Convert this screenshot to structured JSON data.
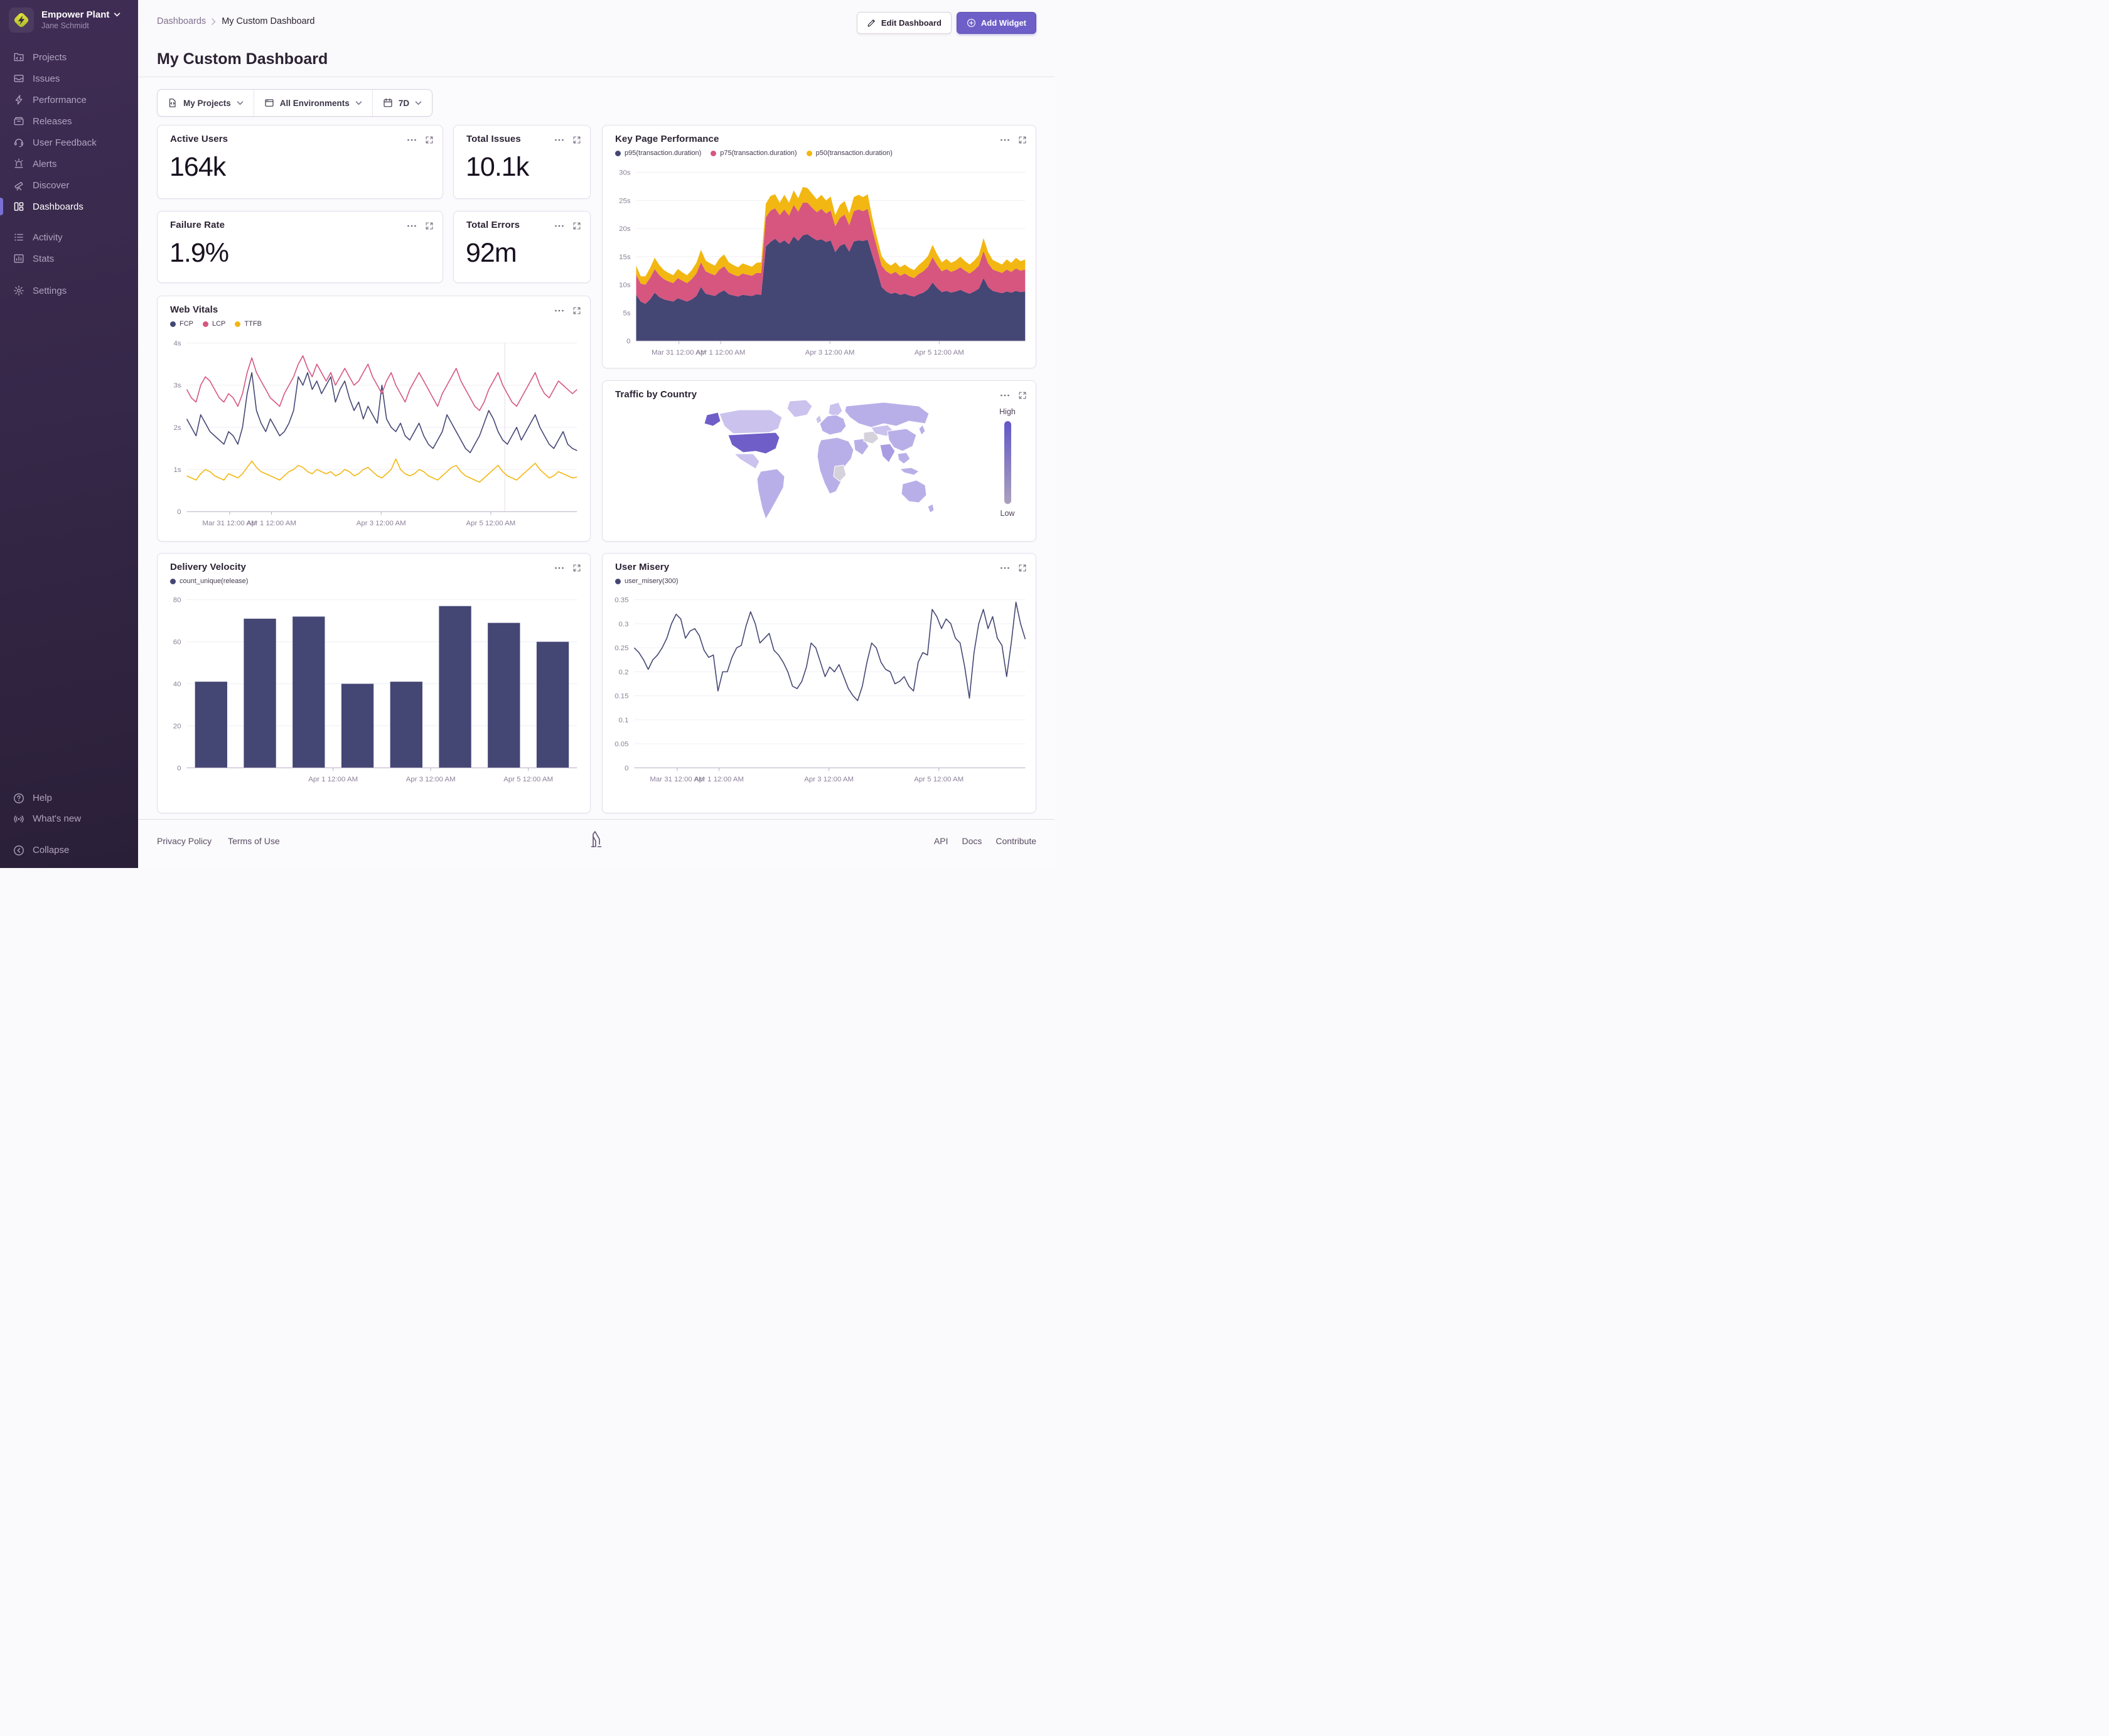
{
  "sidebar": {
    "org": "Empower Plant",
    "user": "Jane Schmidt",
    "items": [
      {
        "label": "Projects"
      },
      {
        "label": "Issues"
      },
      {
        "label": "Performance"
      },
      {
        "label": "Releases"
      },
      {
        "label": "User Feedback"
      },
      {
        "label": "Alerts"
      },
      {
        "label": "Discover"
      },
      {
        "label": "Dashboards",
        "active": true
      },
      {
        "label": "Activity"
      },
      {
        "label": "Stats"
      },
      {
        "label": "Settings"
      }
    ],
    "footer": [
      {
        "label": "Help"
      },
      {
        "label": "What's new"
      },
      {
        "label": "Collapse"
      }
    ]
  },
  "header": {
    "breadcrumb_parent": "Dashboards",
    "breadcrumb_current": "My Custom Dashboard",
    "title": "My Custom Dashboard",
    "edit_label": "Edit Dashboard",
    "add_label": "Add Widget"
  },
  "filters": {
    "projects": "My Projects",
    "environments": "All Environments",
    "period": "7D"
  },
  "cards": {
    "active_users": {
      "title": "Active Users",
      "value": "164k"
    },
    "total_issues": {
      "title": "Total Issues",
      "value": "10.1k"
    },
    "failure_rate": {
      "title": "Failure Rate",
      "value": "1.9%"
    },
    "total_errors": {
      "title": "Total Errors",
      "value": "92m"
    }
  },
  "footer": {
    "links_left": [
      "Privacy Policy",
      "Terms of Use"
    ],
    "links_right": [
      "API",
      "Docs",
      "Contribute"
    ]
  },
  "colors": {
    "accent": "#6d5fc7",
    "navy": "#444674",
    "pink": "#d6567f",
    "yellow": "#f2b712"
  },
  "chart_data": [
    {
      "id": "key-page-performance",
      "type": "area",
      "stacked": true,
      "title": "Key Page Performance",
      "ylim": [
        0,
        30
      ],
      "yticks": [
        "0",
        "5s",
        "10s",
        "15s",
        "20s",
        "25s",
        "30s"
      ],
      "xticks": [
        {
          "f": 0.11,
          "label": "Mar 31 12:00 AM"
        },
        {
          "f": 0.217,
          "label": "Apr 1 12:00 AM"
        },
        {
          "f": 0.498,
          "label": "Apr 3 12:00 AM"
        },
        {
          "f": 0.779,
          "label": "Apr 5 12:00 AM"
        }
      ],
      "series": [
        {
          "name": "p95(transaction.duration)",
          "color": "#444674",
          "values": [
            8.2,
            7.0,
            6.6,
            7.4,
            8.6,
            7.8,
            7.4,
            7.2,
            7.0,
            7.6,
            7.3,
            7.0,
            7.4,
            8.0,
            9.6,
            8.4,
            8.2,
            8.0,
            8.6,
            9.0,
            8.3,
            8.1,
            7.9,
            8.2,
            8.1,
            8.0,
            8.3,
            8.2,
            16.8,
            17.6,
            18.2,
            17.4,
            17.9,
            17.2,
            18.6,
            17.8,
            18.8,
            19.0,
            18.4,
            17.9,
            18.1,
            17.6,
            17.9,
            15.8,
            16.9,
            17.3,
            15.9,
            17.7,
            17.9,
            17.8,
            18.0,
            15.2,
            12.6,
            9.6,
            8.8,
            8.4,
            8.6,
            8.2,
            8.4,
            8.1,
            7.9,
            8.3,
            8.6,
            9.2,
            10.4,
            9.4,
            8.7,
            8.9,
            8.6,
            8.8,
            9.1,
            8.7,
            8.4,
            8.8,
            9.3,
            11.2,
            9.6,
            8.9,
            8.7,
            8.5,
            8.8,
            8.6,
            8.9,
            8.7,
            8.8
          ]
        },
        {
          "name": "p75(transaction.duration)",
          "color": "#d6567f",
          "values": [
            3.6,
            3.2,
            3.4,
            3.8,
            4.2,
            3.9,
            3.6,
            3.4,
            3.3,
            3.6,
            3.4,
            3.3,
            3.6,
            4.0,
            4.4,
            4.0,
            3.8,
            3.7,
            4.1,
            4.3,
            3.9,
            3.7,
            3.6,
            3.8,
            3.7,
            3.6,
            3.8,
            3.9,
            5.2,
            5.6,
            5.4,
            5.0,
            5.5,
            5.1,
            5.6,
            5.2,
            5.8,
            5.6,
            5.3,
            5.0,
            5.4,
            5.1,
            5.3,
            4.6,
            5.0,
            5.2,
            4.7,
            5.4,
            5.5,
            5.3,
            5.5,
            4.6,
            4.0,
            3.8,
            3.6,
            3.5,
            3.7,
            3.4,
            3.6,
            3.4,
            3.3,
            3.6,
            3.8,
            4.0,
            4.5,
            4.1,
            3.7,
            3.9,
            3.7,
            3.8,
            4.0,
            3.8,
            3.6,
            3.8,
            4.1,
            4.8,
            4.2,
            3.8,
            3.7,
            3.6,
            3.9,
            3.7,
            4.0,
            3.8,
            3.9
          ]
        },
        {
          "name": "p50(transaction.duration)",
          "color": "#f2b712",
          "values": [
            1.6,
            1.3,
            1.5,
            1.8,
            2.0,
            1.8,
            1.6,
            1.5,
            1.4,
            1.6,
            1.5,
            1.4,
            1.6,
            1.9,
            2.2,
            1.9,
            1.8,
            1.7,
            2.0,
            2.1,
            1.8,
            1.7,
            1.6,
            1.8,
            1.7,
            1.6,
            1.8,
            1.9,
            2.4,
            2.6,
            2.5,
            2.2,
            2.6,
            2.3,
            2.6,
            2.4,
            2.8,
            2.6,
            2.5,
            2.3,
            2.5,
            2.3,
            2.5,
            2.0,
            2.3,
            2.4,
            2.1,
            2.5,
            2.6,
            2.5,
            2.6,
            2.1,
            1.8,
            1.7,
            1.6,
            1.5,
            1.7,
            1.5,
            1.6,
            1.5,
            1.4,
            1.6,
            1.8,
            1.9,
            2.2,
            1.9,
            1.6,
            1.8,
            1.6,
            1.7,
            1.9,
            1.7,
            1.6,
            1.7,
            1.9,
            2.3,
            2.0,
            1.7,
            1.6,
            1.5,
            1.8,
            1.6,
            1.9,
            1.7,
            1.8
          ]
        }
      ]
    },
    {
      "id": "web-vitals",
      "type": "line",
      "title": "Web Vitals",
      "ylim": [
        0,
        4
      ],
      "yticks": [
        "0",
        "1s",
        "2s",
        "3s",
        "4s"
      ],
      "vline": 0.815,
      "xticks": [
        {
          "f": 0.11,
          "label": "Mar 31 12:00 AM"
        },
        {
          "f": 0.217,
          "label": "Apr 1 12:00 AM"
        },
        {
          "f": 0.498,
          "label": "Apr 3 12:00 AM"
        },
        {
          "f": 0.779,
          "label": "Apr 5 12:00 AM"
        }
      ],
      "series": [
        {
          "name": "FCP",
          "color": "#444674",
          "values": [
            2.2,
            2.0,
            1.8,
            2.3,
            2.1,
            1.9,
            1.8,
            1.7,
            1.6,
            1.9,
            1.8,
            1.6,
            2.0,
            2.8,
            3.3,
            2.4,
            2.1,
            1.9,
            2.2,
            2.0,
            1.8,
            1.9,
            2.1,
            2.4,
            3.2,
            3.0,
            3.3,
            2.9,
            3.1,
            2.8,
            3.0,
            3.2,
            2.6,
            2.9,
            3.1,
            2.7,
            2.4,
            2.6,
            2.2,
            2.5,
            2.3,
            2.1,
            3.0,
            2.2,
            2.0,
            1.9,
            2.1,
            1.8,
            1.7,
            1.9,
            2.1,
            1.8,
            1.6,
            1.5,
            1.7,
            1.9,
            2.3,
            2.1,
            1.9,
            1.7,
            1.5,
            1.4,
            1.6,
            1.8,
            2.1,
            2.4,
            2.2,
            1.9,
            1.7,
            1.6,
            1.8,
            2.0,
            1.7,
            1.9,
            2.1,
            2.3,
            2.0,
            1.8,
            1.6,
            1.5,
            1.7,
            1.9,
            1.6,
            1.5,
            1.45
          ]
        },
        {
          "name": "LCP",
          "color": "#d6567f",
          "values": [
            2.9,
            2.7,
            2.6,
            3.0,
            3.2,
            3.1,
            2.9,
            2.7,
            2.6,
            2.8,
            2.7,
            2.5,
            2.8,
            3.3,
            3.65,
            3.3,
            3.1,
            2.9,
            2.7,
            2.6,
            2.5,
            2.8,
            3.0,
            3.2,
            3.5,
            3.7,
            3.4,
            3.2,
            3.5,
            3.3,
            3.1,
            3.3,
            3.0,
            3.2,
            3.4,
            3.2,
            3.0,
            3.1,
            3.3,
            3.5,
            3.2,
            3.0,
            2.8,
            3.1,
            3.3,
            3.0,
            2.8,
            2.6,
            2.9,
            3.1,
            3.3,
            3.1,
            2.9,
            2.7,
            2.5,
            2.8,
            3.0,
            3.2,
            3.4,
            3.1,
            2.9,
            2.7,
            2.5,
            2.4,
            2.6,
            2.9,
            3.1,
            3.3,
            3.0,
            2.8,
            2.6,
            2.5,
            2.7,
            2.9,
            3.1,
            3.3,
            3.0,
            2.8,
            2.7,
            2.9,
            3.1,
            3.0,
            2.9,
            2.8,
            2.9
          ]
        },
        {
          "name": "TTFB",
          "color": "#f2b712",
          "values": [
            0.85,
            0.8,
            0.75,
            0.9,
            1.0,
            0.95,
            0.85,
            0.8,
            0.75,
            0.9,
            0.85,
            0.8,
            0.9,
            1.05,
            1.2,
            1.05,
            0.95,
            0.9,
            0.85,
            0.8,
            0.75,
            0.85,
            0.95,
            1.0,
            1.1,
            1.05,
            0.95,
            0.9,
            1.0,
            0.95,
            0.9,
            0.95,
            0.85,
            0.9,
            1.0,
            0.95,
            0.85,
            0.9,
            1.0,
            1.05,
            0.95,
            0.85,
            0.8,
            0.9,
            1.0,
            1.25,
            1.0,
            0.9,
            0.85,
            0.9,
            1.0,
            0.95,
            0.85,
            0.8,
            0.75,
            0.85,
            0.95,
            1.05,
            1.1,
            0.95,
            0.85,
            0.8,
            0.75,
            0.7,
            0.8,
            0.9,
            1.0,
            1.1,
            0.95,
            0.85,
            0.8,
            0.75,
            0.85,
            0.95,
            1.05,
            1.15,
            1.0,
            0.9,
            0.8,
            0.85,
            0.95,
            0.9,
            0.85,
            0.8,
            0.82
          ]
        }
      ]
    },
    {
      "id": "traffic-by-country",
      "type": "choropleth",
      "title": "Traffic by Country",
      "legend_high": "High",
      "legend_low": "Low",
      "highlight": "United States",
      "palette": {
        "base": "#b9afe8",
        "light": "#cbc3ee",
        "mid": "#a99ce2",
        "dark": "#6f5ec8",
        "muted": "#d6d2dc",
        "legend_top": "#6358c8",
        "legend_bottom": "#aaa1bd"
      }
    },
    {
      "id": "delivery-velocity",
      "type": "bar",
      "title": "Delivery Velocity",
      "ylim": [
        0,
        80
      ],
      "yticks": [
        "0",
        "20",
        "40",
        "60",
        "80"
      ],
      "xticks": [
        {
          "f": 0.375,
          "label": "Apr 1 12:00 AM"
        },
        {
          "f": 0.625,
          "label": "Apr 3 12:00 AM"
        },
        {
          "f": 0.875,
          "label": "Apr 5 12:00 AM"
        }
      ],
      "series": [
        {
          "name": "count_unique(release)",
          "color": "#444674",
          "values": [
            41,
            71,
            72,
            40,
            41,
            77,
            69,
            60
          ]
        }
      ]
    },
    {
      "id": "user-misery",
      "type": "line",
      "title": "User Misery",
      "ylim": [
        0,
        0.35
      ],
      "yticks": [
        "0",
        "0.05",
        "0.1",
        "0.15",
        "0.2",
        "0.25",
        "0.3",
        "0.35"
      ],
      "xticks": [
        {
          "f": 0.11,
          "label": "Mar 31 12:00 AM"
        },
        {
          "f": 0.217,
          "label": "Apr 1 12:00 AM"
        },
        {
          "f": 0.498,
          "label": "Apr 3 12:00 AM"
        },
        {
          "f": 0.779,
          "label": "Apr 5 12:00 AM"
        }
      ],
      "series": [
        {
          "name": "user_misery(300)",
          "color": "#444674",
          "values": [
            0.25,
            0.24,
            0.225,
            0.205,
            0.225,
            0.235,
            0.25,
            0.27,
            0.3,
            0.32,
            0.31,
            0.27,
            0.285,
            0.29,
            0.275,
            0.245,
            0.23,
            0.235,
            0.16,
            0.2,
            0.2,
            0.23,
            0.25,
            0.255,
            0.295,
            0.325,
            0.3,
            0.26,
            0.27,
            0.28,
            0.245,
            0.235,
            0.22,
            0.2,
            0.17,
            0.165,
            0.18,
            0.21,
            0.26,
            0.25,
            0.22,
            0.19,
            0.21,
            0.2,
            0.215,
            0.19,
            0.165,
            0.15,
            0.14,
            0.17,
            0.22,
            0.26,
            0.25,
            0.22,
            0.205,
            0.2,
            0.175,
            0.18,
            0.19,
            0.17,
            0.16,
            0.22,
            0.24,
            0.235,
            0.33,
            0.315,
            0.29,
            0.31,
            0.3,
            0.27,
            0.26,
            0.21,
            0.145,
            0.24,
            0.3,
            0.33,
            0.29,
            0.315,
            0.27,
            0.255,
            0.19,
            0.26,
            0.345,
            0.3,
            0.268
          ]
        }
      ]
    }
  ]
}
